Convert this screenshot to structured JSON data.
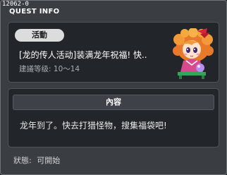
{
  "window": {
    "id": "12062-0",
    "title": "QUEST INFO"
  },
  "quest": {
    "badge": "活動",
    "name": "[龙的传人活动]装满龙年祝福! 快..",
    "level_label": "建議等级:",
    "level_value": "10～14",
    "npc_icon": "npc-girl-portrait"
  },
  "content": {
    "header": "內容",
    "text": "龙年到了。快去打猎怪物，搜集福袋吧!"
  },
  "status": {
    "label": "狀態:",
    "value": "可開始"
  }
}
